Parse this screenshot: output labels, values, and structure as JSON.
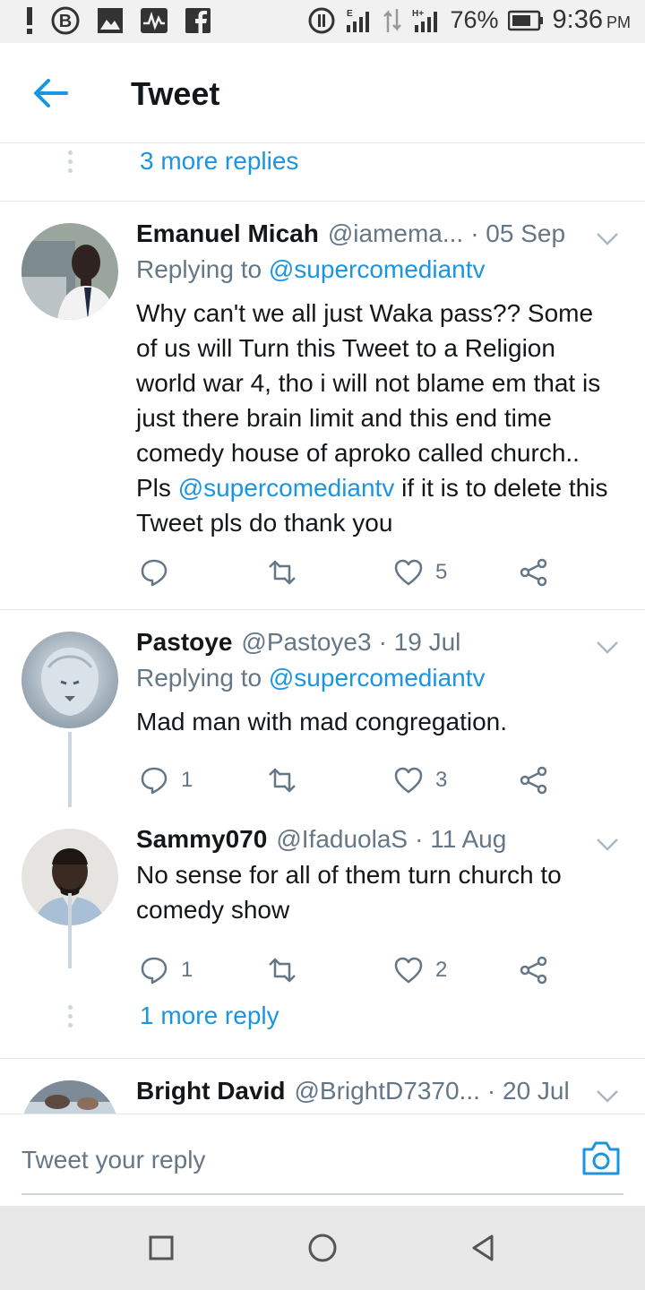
{
  "status_bar": {
    "battery": "76%",
    "time": "9:36",
    "ampm": "PM",
    "icons": [
      "notification-alert-icon",
      "b-app-icon",
      "gallery-icon",
      "activity-icon",
      "facebook-icon",
      "sync-icon",
      "signal-e-icon",
      "data-transfer-icon",
      "signal-h-plus-icon",
      "battery-icon"
    ]
  },
  "header": {
    "title": "Tweet",
    "back_icon": "back-arrow-icon"
  },
  "thread_top": {
    "more_replies": "3 more replies"
  },
  "tweets": [
    {
      "name": "Emanuel Micah",
      "handle": "@iamema...",
      "date": "· 05 Sep",
      "replying_prefix": "Replying to ",
      "replying_to": "@supercomediantv",
      "body_pre": "Why can't we all just Waka pass?? Some of us will Turn this Tweet to a Religion world war 4, tho i will not blame em that is just there brain limit and this end time comedy house of aproko called church.. Pls ",
      "body_mention": "@supercomediantv",
      "body_post": " if it is to delete this Tweet pls do thank you",
      "replies": "",
      "likes": "5"
    },
    {
      "name": "Pastoye",
      "handle": "@Pastoye3",
      "date": "· 19 Jul",
      "replying_prefix": "Replying to ",
      "replying_to": "@supercomediantv",
      "body": "Mad man with mad congregation.",
      "replies": "1",
      "likes": "3"
    },
    {
      "name": "Sammy070",
      "handle": "@IfaduolaS",
      "date": "· 11 Aug",
      "body": "No sense for all of them turn church to comedy show",
      "replies": "1",
      "likes": "2"
    },
    {
      "name": "Bright David",
      "handle": "@BrightD7370...",
      "date": "· 20 Jul"
    }
  ],
  "thread_bottom": {
    "more_replies": "1 more reply"
  },
  "reply_bar": {
    "placeholder": "Tweet your reply"
  },
  "colors": {
    "accent": "#1b95e0",
    "secondary_text": "#657786",
    "divider": "#e1e8ed"
  }
}
